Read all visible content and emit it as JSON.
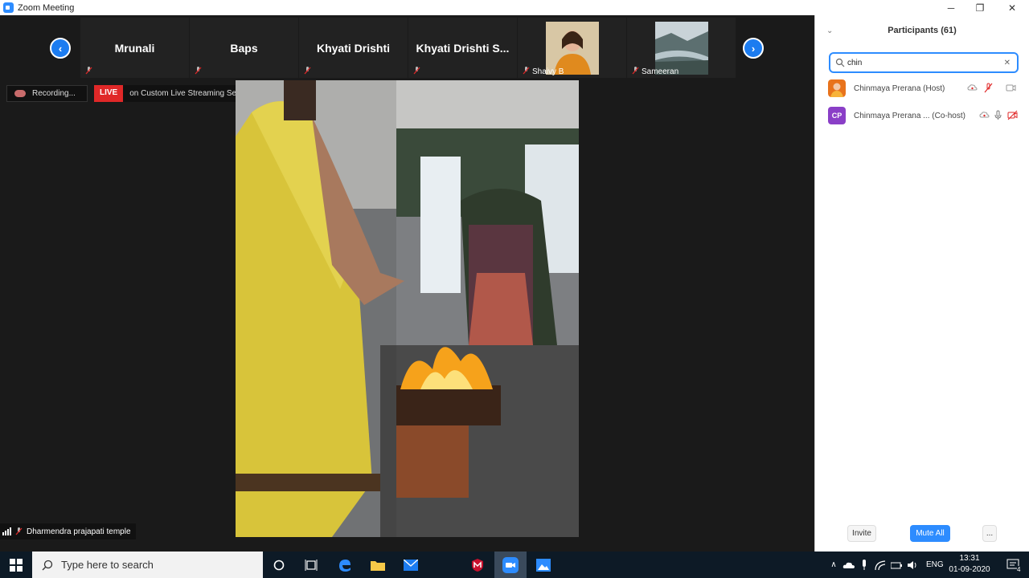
{
  "window": {
    "title": "Zoom Meeting",
    "controls": {
      "minimize": "─",
      "maximize": "❐",
      "close": "✕"
    }
  },
  "strip": {
    "prev_icon": "chevron-left-icon",
    "next_icon": "chevron-right-icon",
    "tiles": [
      {
        "name": "Mrunali",
        "muted": true
      },
      {
        "name": "Baps",
        "muted": true
      },
      {
        "name": "Khyati Drishti",
        "muted": true
      },
      {
        "name": "Khyati  Drishti  S...",
        "muted": true
      },
      {
        "name": "Shaivy B",
        "muted": true,
        "has_photo": true
      },
      {
        "name": "Sameeran",
        "muted": true,
        "has_photo": true
      }
    ]
  },
  "recording": {
    "label": "Recording..."
  },
  "live": {
    "badge": "LIVE",
    "service": "on Custom Live Streaming Service"
  },
  "active_speaker": {
    "name": "Dharmendra prajapati temple",
    "muted": true
  },
  "participants": {
    "title": "Participants (61)",
    "search": {
      "value": "chin",
      "placeholder": ""
    },
    "rows": [
      {
        "name": "Chinmaya Prerana (Host)",
        "avatar_text": "",
        "avatar_color": "#e8731c",
        "mic": "muted",
        "video": "on",
        "recording": true
      },
      {
        "name": "Chinmaya Prerana ...  (Co-host)",
        "avatar_text": "CP",
        "avatar_color": "#8a3fc7",
        "mic": "on",
        "video": "off",
        "recording": true
      }
    ],
    "buttons": {
      "invite": "Invite",
      "mute_all": "Mute All",
      "more": "..."
    }
  },
  "taskbar": {
    "search_text": "Type here to search",
    "tray": {
      "language": "ENG",
      "time": "13:31",
      "date": "01-09-2020",
      "notifications": "4"
    }
  },
  "colors": {
    "accent": "#2d8cff",
    "live": "#e02828",
    "taskbar": "#0d1a26"
  }
}
